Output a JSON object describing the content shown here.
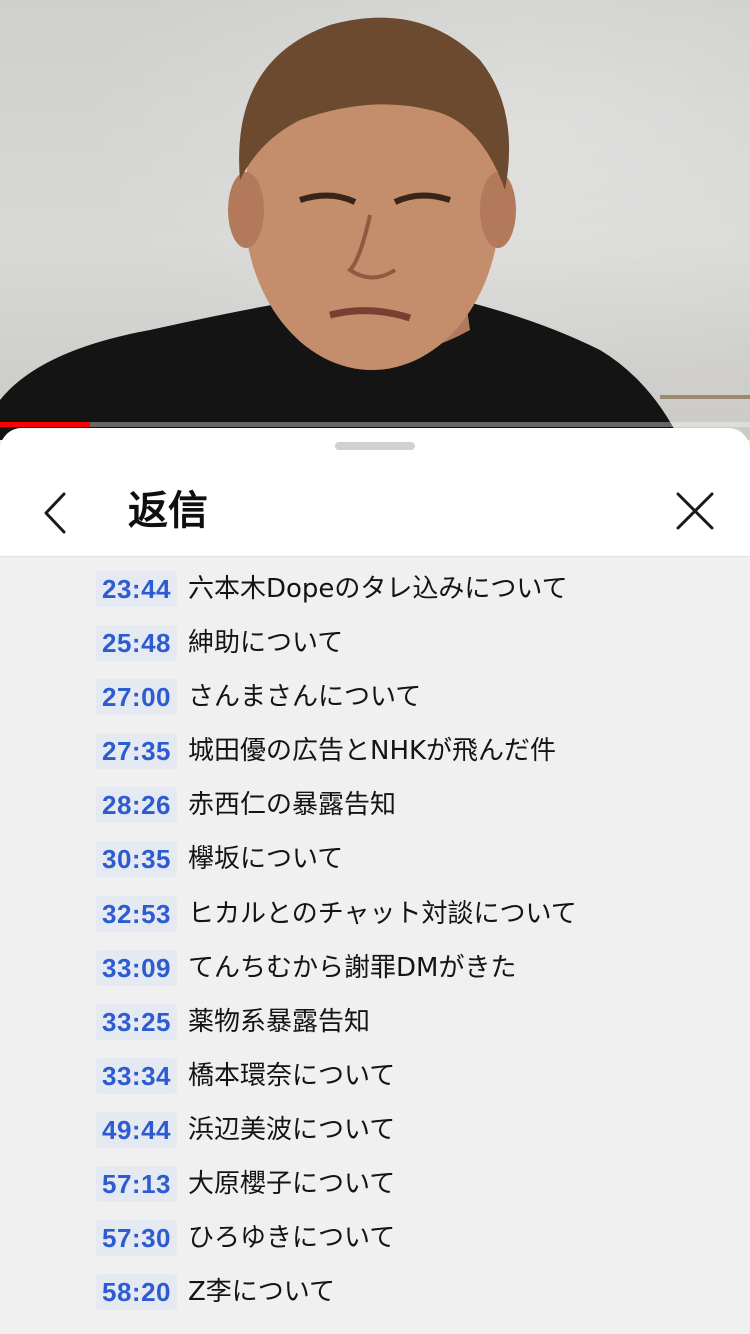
{
  "video": {
    "progress_fraction": 0.12
  },
  "sheet": {
    "title": "返信"
  },
  "chapters": [
    {
      "time": "23:44",
      "label": "六本木Dopeのタレ込みについて"
    },
    {
      "time": "25:48",
      "label": "紳助について"
    },
    {
      "time": "27:00",
      "label": "さんまさんについて"
    },
    {
      "time": "27:35",
      "label": "城田優の広告とNHKが飛んだ件"
    },
    {
      "time": "28:26",
      "label": "赤西仁の暴露告知"
    },
    {
      "time": "30:35",
      "label": "欅坂について"
    },
    {
      "time": "32:53",
      "label": "ヒカルとのチャット対談について"
    },
    {
      "time": "33:09",
      "label": "てんちむから謝罪DMがきた"
    },
    {
      "time": "33:25",
      "label": "薬物系暴露告知"
    },
    {
      "time": "33:34",
      "label": "橋本環奈について"
    },
    {
      "time": "49:44",
      "label": "浜辺美波について"
    },
    {
      "time": "57:13",
      "label": "大原櫻子について"
    },
    {
      "time": "57:30",
      "label": "ひろゆきについて"
    },
    {
      "time": "58:20",
      "label": "Z李について"
    }
  ],
  "icons": {
    "back": "chevron-left-icon",
    "close": "close-icon"
  },
  "colors": {
    "timestamp_link": "#2d5bd0",
    "progress": "#ff0000"
  }
}
